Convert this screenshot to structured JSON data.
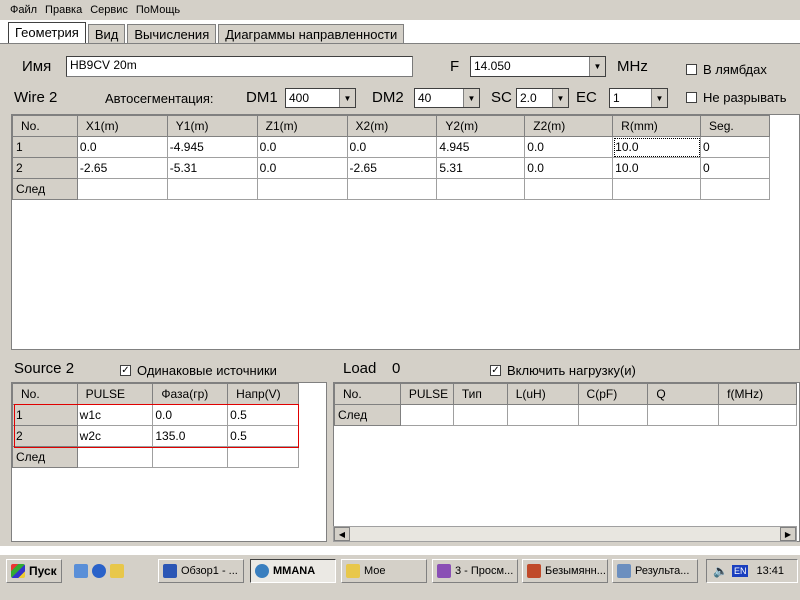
{
  "menu": [
    "Файл",
    "Правка",
    "Сервис",
    "ПоМощь"
  ],
  "tabs": [
    "Геометрия",
    "Вид",
    "Вычисления",
    "Диаграммы направленности"
  ],
  "header": {
    "name_label": "Имя",
    "name_value": "HB9CV 20m",
    "freq_label": "F",
    "freq_value": "14.050",
    "freq_unit": "MHz",
    "in_lambdas": "В лямбдах",
    "no_break": "Не разрывать"
  },
  "wire": {
    "title": "Wire 2",
    "autoseg_label": "Автосегментация:",
    "dm1_label": "DM1",
    "dm1_value": "400",
    "dm2_label": "DM2",
    "dm2_value": "40",
    "sc_label": "SC",
    "sc_value": "2.0",
    "ec_label": "EC",
    "ec_value": "1",
    "columns": [
      "No.",
      "X1(m)",
      "Y1(m)",
      "Z1(m)",
      "X2(m)",
      "Y2(m)",
      "Z2(m)",
      "R(mm)",
      "Seg."
    ],
    "rows": [
      [
        "1",
        "0.0",
        "-4.945",
        "0.0",
        "0.0",
        "4.945",
        "0.0",
        "10.0",
        "0"
      ],
      [
        "2",
        "-2.65",
        "-5.31",
        "0.0",
        "-2.65",
        "5.31",
        "0.0",
        "10.0",
        "0"
      ]
    ],
    "next_label": "След"
  },
  "source": {
    "title": "Source 2",
    "same_sources": "Одинаковые источники",
    "columns": [
      "No.",
      "PULSE",
      "Фаза(гр)",
      "Напр(V)"
    ],
    "rows": [
      [
        "1",
        "w1c",
        "0.0",
        "0.5"
      ],
      [
        "2",
        "w2c",
        "135.0",
        "0.5"
      ]
    ],
    "next_label": "След"
  },
  "load": {
    "title": "Load",
    "count": "0",
    "enable_load": "Включить нагрузку(и)",
    "columns": [
      "No.",
      "PULSE",
      "Тип",
      "L(uH)",
      "C(pF)",
      "Q",
      "f(MHz)"
    ],
    "next_label": "След"
  },
  "taskbar": {
    "start": "Пуск",
    "items": [
      "Обзор1 - ...",
      "MMANA",
      "Мое",
      "3 - Просм...",
      "Безымянн...",
      "Результа..."
    ],
    "lang": "EN",
    "time": "13:41"
  },
  "colors": {
    "face": "#d4d0c8",
    "highlight": "#e00000",
    "lang_badge": "#1a3fbf"
  },
  "icons": [
    "checkbox-icon",
    "dropdown-arrow-icon",
    "windows-start-icon",
    "speaker-icon",
    "scroll-left-icon",
    "scroll-right-icon"
  ]
}
